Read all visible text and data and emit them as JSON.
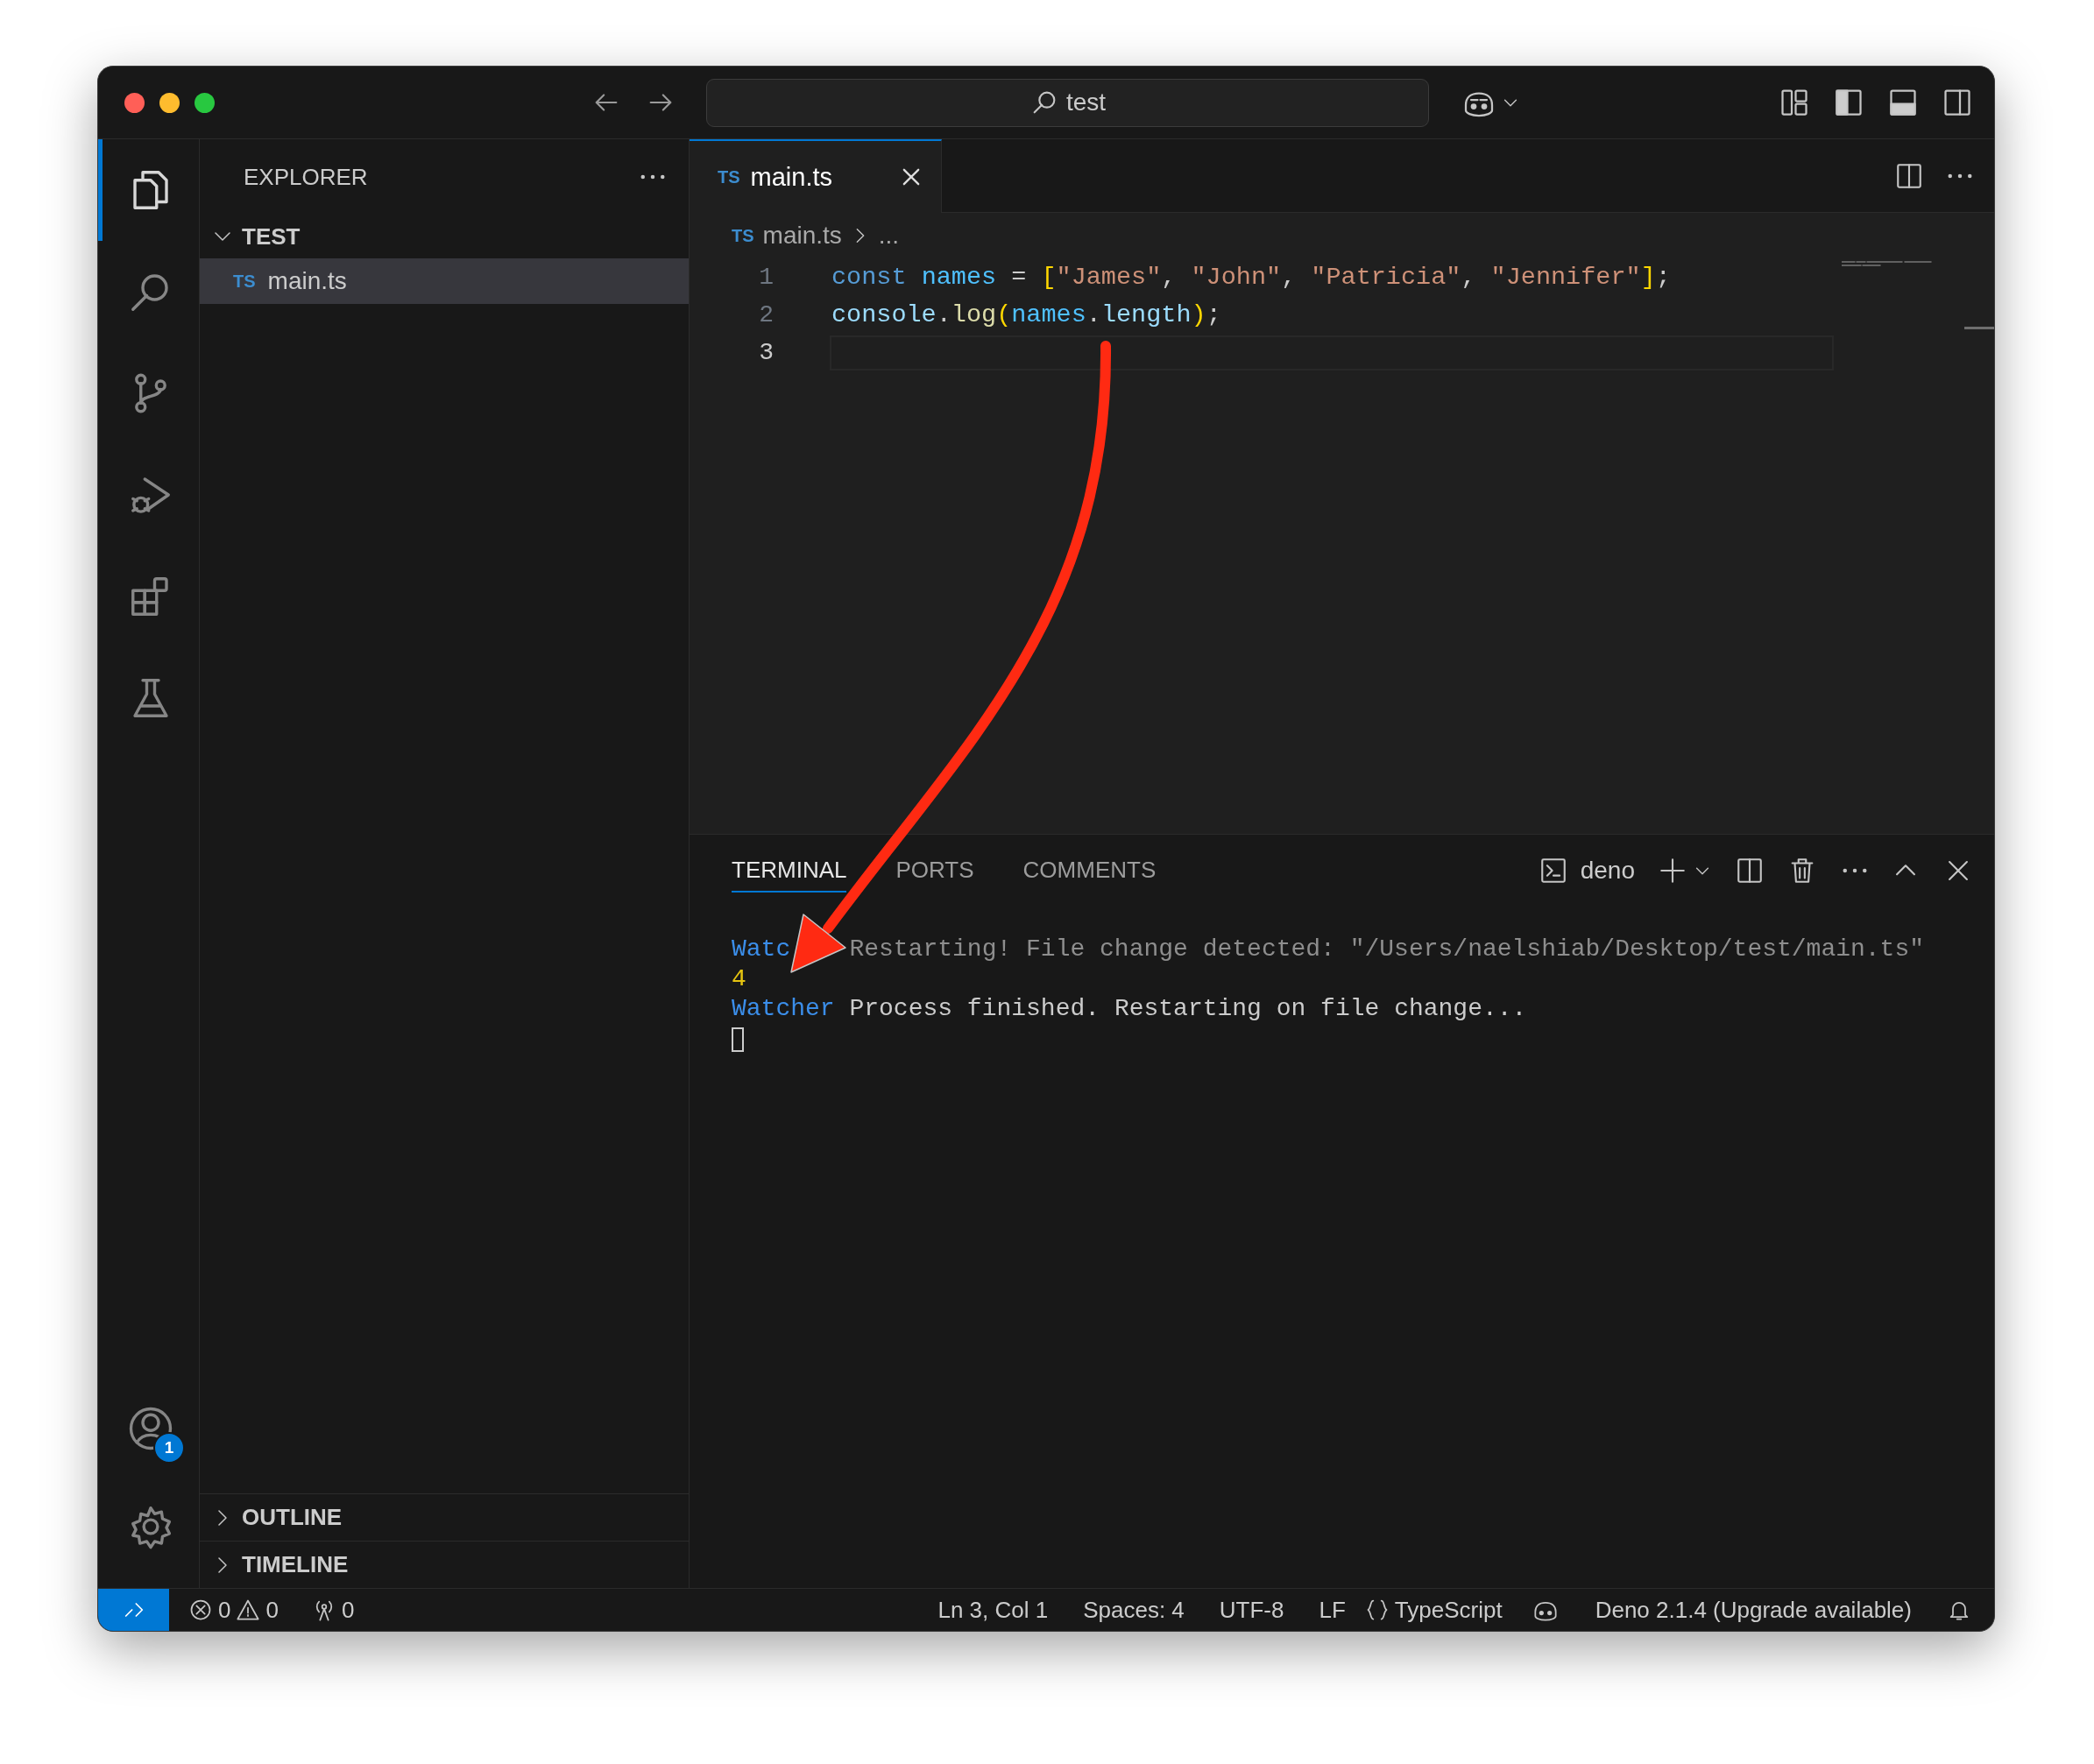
{
  "title_bar": {
    "search": "test"
  },
  "activity_bar": {
    "items": [
      {
        "selected": true
      },
      {
        "selected": false
      },
      {
        "selected": false
      },
      {
        "selected": false
      },
      {
        "selected": false
      },
      {
        "selected": false
      }
    ],
    "accounts_badge": "1"
  },
  "sidebar": {
    "title": "EXPLORER",
    "folder": {
      "name": "TEST",
      "expanded": true,
      "children": [
        {
          "badge": "TS",
          "name": "main.ts",
          "selected": true
        }
      ]
    },
    "sections": [
      {
        "name": "OUTLINE",
        "expanded": false
      },
      {
        "name": "TIMELINE",
        "expanded": false
      }
    ]
  },
  "editor": {
    "tabs": [
      {
        "badge": "TS",
        "label": "main.ts",
        "selected": true
      }
    ],
    "breadcrumb": {
      "badge": "TS",
      "file": "main.ts",
      "more": "..."
    },
    "lines": [
      {
        "number": "1",
        "current": false,
        "tokens": [
          {
            "kind": "keyword",
            "text": "const "
          },
          {
            "kind": "variable",
            "text": "names"
          },
          {
            "kind": "plain",
            "text": " = "
          },
          {
            "kind": "bracket",
            "text": "["
          },
          {
            "kind": "string",
            "text": "\"James\""
          },
          {
            "kind": "plain",
            "text": ", "
          },
          {
            "kind": "string",
            "text": "\"John\""
          },
          {
            "kind": "plain",
            "text": ", "
          },
          {
            "kind": "string",
            "text": "\"Patricia\""
          },
          {
            "kind": "plain",
            "text": ", "
          },
          {
            "kind": "string",
            "text": "\"Jennifer\""
          },
          {
            "kind": "bracket",
            "text": "]"
          },
          {
            "kind": "plain",
            "text": ";"
          }
        ]
      },
      {
        "number": "2",
        "current": false,
        "tokens": [
          {
            "kind": "property",
            "text": "console"
          },
          {
            "kind": "plain",
            "text": "."
          },
          {
            "kind": "function",
            "text": "log"
          },
          {
            "kind": "bracket",
            "text": "("
          },
          {
            "kind": "variable",
            "text": "names"
          },
          {
            "kind": "plain",
            "text": "."
          },
          {
            "kind": "property",
            "text": "length"
          },
          {
            "kind": "bracket",
            "text": ")"
          },
          {
            "kind": "plain",
            "text": ";"
          }
        ]
      },
      {
        "number": "3",
        "current": true
      }
    ]
  },
  "panel": {
    "tabs": [
      {
        "label": "TERMINAL",
        "selected": true
      },
      {
        "label": "PORTS",
        "selected": false
      },
      {
        "label": "COMMENTS",
        "selected": false
      }
    ],
    "terminal_name": "deno",
    "lines": [
      [
        {
          "kind": "label",
          "text": "Watc"
        },
        {
          "kind": "dim",
          "text": " Restarting! File change detected: \"/Users/naelshiab/Desktop/test/main.ts\""
        }
      ],
      [
        {
          "kind": "output",
          "text": "4"
        }
      ],
      [
        {
          "kind": "label",
          "text": "Watcher"
        },
        {
          "kind": "plain",
          "text": " Process finished. Restarting on file change..."
        }
      ]
    ]
  },
  "status_bar": {
    "errors": "0",
    "warnings": "0",
    "ports": "0",
    "items": [
      "Ln 3, Col 1",
      "Spaces: 4",
      "UTF-8",
      "LF"
    ],
    "language": "TypeScript",
    "runtime": "Deno 2.1.4 (Upgrade available)"
  }
}
